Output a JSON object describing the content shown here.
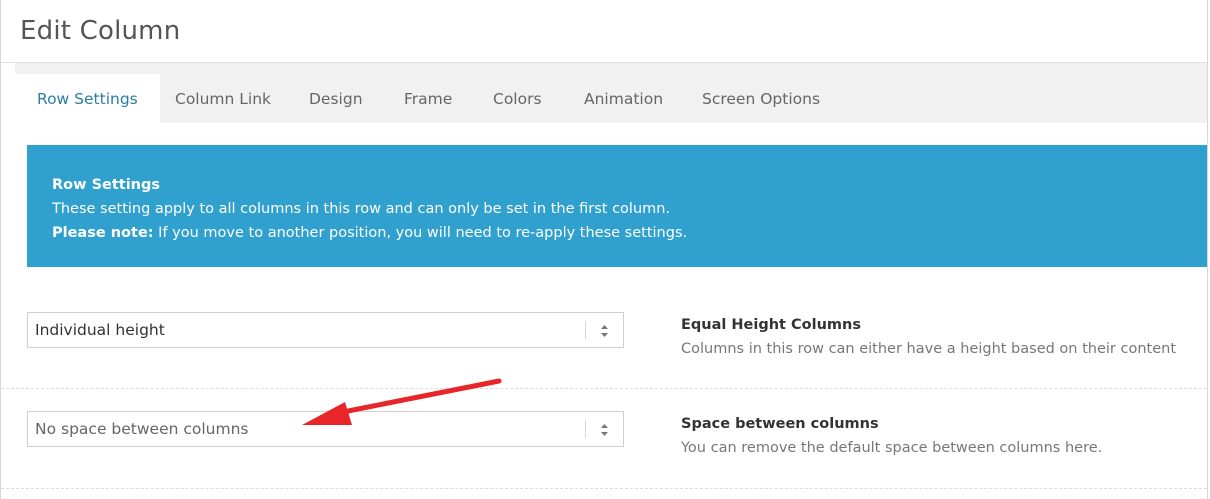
{
  "window": {
    "title": "Edit Column"
  },
  "tabs": [
    {
      "label": "Row Settings",
      "active": true
    },
    {
      "label": "Column Link"
    },
    {
      "label": "Design"
    },
    {
      "label": "Frame"
    },
    {
      "label": "Colors"
    },
    {
      "label": "Animation"
    },
    {
      "label": "Screen Options"
    }
  ],
  "banner": {
    "title": "Row Settings",
    "text": "These setting apply to all columns in this row and can only be set in the first column.",
    "note_label": "Please note:",
    "note_text": " If you move to another position, you will need to re-apply these settings."
  },
  "settings": [
    {
      "selected": "Individual height",
      "title": "Equal Height Columns",
      "description": "Columns in this row can either have a height based on their content"
    },
    {
      "selected": "No space between columns",
      "title": "Space between columns",
      "description": "You can remove the default space between columns here."
    }
  ],
  "colors": {
    "accent": "#30a1cf",
    "active_tab_text": "#2a7fa4",
    "annotation_arrow": "#e8262a"
  },
  "icons": {
    "select_arrows": "updown-arrows-icon",
    "annotation": "red-arrow-annotation"
  }
}
